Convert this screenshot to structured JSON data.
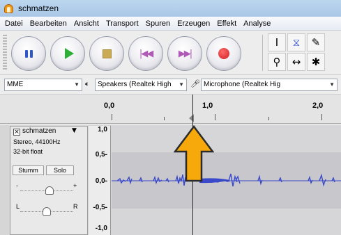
{
  "window": {
    "title": "schmatzen"
  },
  "menu": [
    "Datei",
    "Bearbeiten",
    "Ansicht",
    "Transport",
    "Spuren",
    "Erzeugen",
    "Effekt",
    "Analyse"
  ],
  "transport": {
    "buttons": [
      "pause-icon",
      "play-icon",
      "stop-icon",
      "skip-start-icon",
      "skip-end-icon",
      "record-icon"
    ]
  },
  "tools": {
    "icons": [
      "selection-tool-icon",
      "envelope-tool-icon",
      "draw-tool-icon",
      "zoom-tool-icon",
      "timeshift-tool-icon",
      "multi-tool-icon"
    ]
  },
  "devices": {
    "host": "MME",
    "playback": "Speakers (Realtek High",
    "recording": "Microphone (Realtek Hig"
  },
  "ruler": {
    "labels": [
      "0,0",
      "1,0",
      "2,0"
    ]
  },
  "track": {
    "name": "schmatzen",
    "format": "Stereo, 44100Hz",
    "bit_depth": "32-bit float",
    "mute_label": "Stumm",
    "solo_label": "Solo",
    "gain_minus": "-",
    "gain_plus": "+",
    "pan_left": "L",
    "pan_right": "R",
    "gain_level": 0.55,
    "pan_level": 0.5
  },
  "amplitude_labels": [
    "1,0",
    "0,5-",
    "0,0-",
    "-0,5-",
    "-1,0"
  ],
  "colors": {
    "waveform": "#3a49c9",
    "arrow_fill": "#f7a90c",
    "arrow_outline": "#2b2b2b",
    "record": "#d01f1f",
    "play": "#2faf38"
  }
}
